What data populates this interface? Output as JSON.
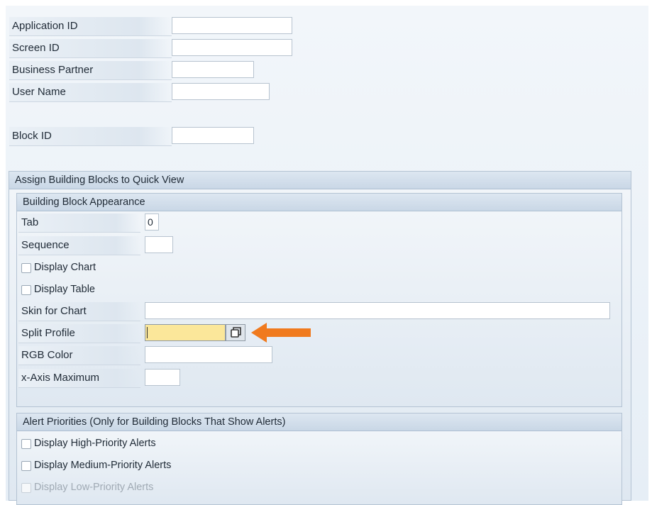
{
  "fields": {
    "application_id": {
      "label": "Application ID",
      "value": ""
    },
    "screen_id": {
      "label": "Screen ID",
      "value": ""
    },
    "business_partner": {
      "label": "Business Partner",
      "value": ""
    },
    "user_name": {
      "label": "User Name",
      "value": ""
    },
    "block_id": {
      "label": "Block ID",
      "value": ""
    }
  },
  "assign_section": {
    "title": "Assign Building Blocks to Quick View",
    "appearance": {
      "title": "Building Block Appearance",
      "tab": {
        "label": "Tab",
        "value": "0"
      },
      "sequence": {
        "label": "Sequence",
        "value": ""
      },
      "display_chart": {
        "label": "Display Chart",
        "checked": false
      },
      "display_table": {
        "label": "Display Table",
        "checked": false
      },
      "skin_for_chart": {
        "label": "Skin for Chart",
        "value": ""
      },
      "split_profile": {
        "label": "Split Profile",
        "value": ""
      },
      "rgb_color": {
        "label": "RGB Color",
        "value": ""
      },
      "x_axis_maximum": {
        "label": "x-Axis Maximum",
        "value": ""
      }
    },
    "alerts": {
      "title": "Alert Priorities (Only for Building Blocks That Show Alerts)",
      "high": {
        "label": "Display High-Priority Alerts",
        "checked": false
      },
      "medium": {
        "label": "Display Medium-Priority Alerts",
        "checked": false
      },
      "low": {
        "label": "Display Low-Priority Alerts",
        "checked": false,
        "disabled": true
      }
    }
  },
  "colors": {
    "highlight_field": "#fbe79a",
    "arrow": "#f07a1e"
  },
  "icons": {
    "value_help": "value-help-icon",
    "arrow": "arrow-left-icon"
  }
}
